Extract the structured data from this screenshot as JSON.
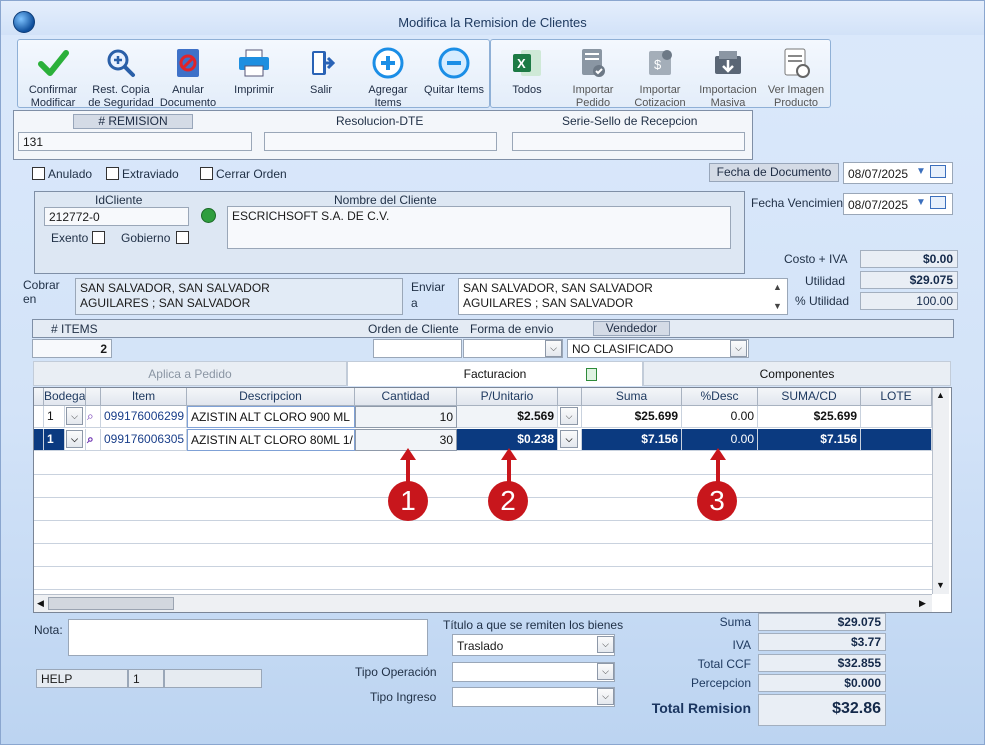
{
  "window": {
    "title": "Modifica la Remision de Clientes"
  },
  "toolbar": {
    "confirm": "Confirmar Modificar",
    "restore": "Rest. Copia de Seguridad",
    "void": "Anular Documento",
    "print": "Imprimir",
    "exit": "Salir",
    "add_items": "Agregar Items",
    "remove_items": "Quitar Items",
    "all": "Todos",
    "import_order": "Importar Pedido",
    "import_quote": "Importar Cotizacion",
    "bulk_import": "Importacion Masiva",
    "product_image": "Ver Imagen Producto"
  },
  "header": {
    "remision_label": "# REMISION",
    "remision_value": "131",
    "resolucion_label": "Resolucion-DTE",
    "resolucion_value": "",
    "serie_label": "Serie-Sello de Recepcion",
    "serie_value": ""
  },
  "flags": {
    "anulado": "Anulado",
    "extraviado": "Extraviado",
    "cerrar": "Cerrar Orden"
  },
  "dates": {
    "doc_label": "Fecha de  Documento",
    "doc_value": "08/07/2025",
    "due_label": "Fecha Vencimiento",
    "due_value": "08/07/2025"
  },
  "client": {
    "id_label": "IdCliente",
    "id_value": "212772-0",
    "name_label": "Nombre del Cliente",
    "name_value": "ESCRICHSOFT S.A. DE C.V.",
    "exento": "Exento",
    "gobierno": "Gobierno"
  },
  "summary": {
    "costo_label": "Costo + IVA",
    "costo_value": "$0.00",
    "utilidad_label": "Utilidad",
    "utilidad_value": "$29.075",
    "putil_label": "% Utilidad",
    "putil_value": "100.00"
  },
  "address": {
    "cobrar_label": "Cobrar en",
    "cobrar_value_1": "SAN SALVADOR, SAN SALVADOR",
    "cobrar_value_2": "AGUILARES ; SAN SALVADOR",
    "enviar_label": "Enviar a",
    "enviar_value_1": "SAN SALVADOR, SAN SALVADOR",
    "enviar_value_2": "AGUILARES ; SAN SALVADOR"
  },
  "order": {
    "items_label": "# ITEMS",
    "items_value": "2",
    "orden_label": "Orden de Cliente",
    "orden_value": "",
    "envio_label": "Forma de envio",
    "envio_value": "",
    "vendedor_label": "Vendedor",
    "vendedor_value": "NO CLASIFICADO"
  },
  "tabs": {
    "t1": "Aplica a Pedido",
    "t2": "Facturacion",
    "t3": "Componentes"
  },
  "grid": {
    "columns": {
      "bodega": "Bodega",
      "item": "Item",
      "descripcion": "Descripcion",
      "cantidad": "Cantidad",
      "punitario": "P/Unitario",
      "suma": "Suma",
      "desc": "%Desc",
      "sumacd": "SUMA/CD",
      "lote": "LOTE"
    },
    "rows": [
      {
        "bodega": "1",
        "item": "099176006299",
        "descripcion": "AZISTIN ALT CLORO 900 ML",
        "cantidad": "10",
        "punitario": "$2.569",
        "suma": "$25.699",
        "desc": "0.00",
        "sumacd": "$25.699"
      },
      {
        "bodega": "1",
        "item": "099176006305",
        "descripcion": "AZISTIN ALT CLORO 80ML 1/",
        "cantidad": "30",
        "punitario": "$0.238",
        "suma": "$7.156",
        "desc": "0.00",
        "sumacd": "$7.156"
      }
    ]
  },
  "markers": {
    "m1": "1",
    "m2": "2",
    "m3": "3"
  },
  "footer": {
    "nota_label": "Nota:",
    "titulo_label": "Título a que se remiten los bienes",
    "titulo_value": "Traslado",
    "tipo_op_label": "Tipo Operación",
    "tipo_ing_label": "Tipo Ingreso",
    "help_label": "HELP",
    "help_value": "1"
  },
  "totals": {
    "suma_label": "Suma",
    "suma_value": "$29.075",
    "iva_label": "IVA",
    "iva_value": "$3.77",
    "ccf_label": "Total CCF",
    "ccf_value": "$32.855",
    "perc_label": "Percepcion",
    "perc_value": "$0.000",
    "total_label": "Total Remision",
    "total_value": "$32.86"
  },
  "colors": {
    "selected_row": "#0b3a80",
    "marker": "#c8161c",
    "accent": "#1f3a60"
  }
}
